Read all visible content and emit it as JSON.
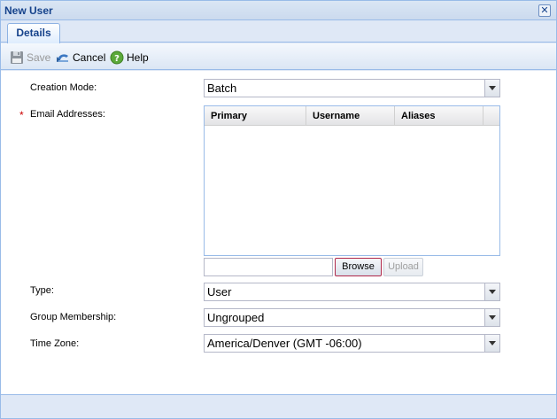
{
  "window": {
    "title": "New User",
    "close_glyph": "✕"
  },
  "tabs": [
    {
      "label": "Details",
      "active": true
    }
  ],
  "toolbar": {
    "save_label": "Save",
    "cancel_label": "Cancel",
    "help_label": "Help",
    "save_icon": "floppy-disk-icon",
    "cancel_icon": "cancel-arrow-icon",
    "help_icon": "question-mark-icon"
  },
  "form": {
    "creation_mode": {
      "label": "Creation Mode:",
      "value": "Batch"
    },
    "email_addresses": {
      "label": "Email Addresses:",
      "required_marker": "*",
      "columns": [
        "Primary",
        "Username",
        "Aliases"
      ],
      "rows": []
    },
    "upload": {
      "file_value": "",
      "browse_label": "Browse",
      "upload_label": "Upload"
    },
    "type": {
      "label": "Type:",
      "value": "User"
    },
    "group_membership": {
      "label": "Group Membership:",
      "value": "Ungrouped"
    },
    "time_zone": {
      "label": "Time Zone:",
      "value": "America/Denver (GMT -06:00)"
    }
  },
  "colors": {
    "header_blue": "#15428b",
    "panel_bg": "#dfe8f6",
    "border_blue": "#99bbe8",
    "required_red": "#cc0000"
  }
}
